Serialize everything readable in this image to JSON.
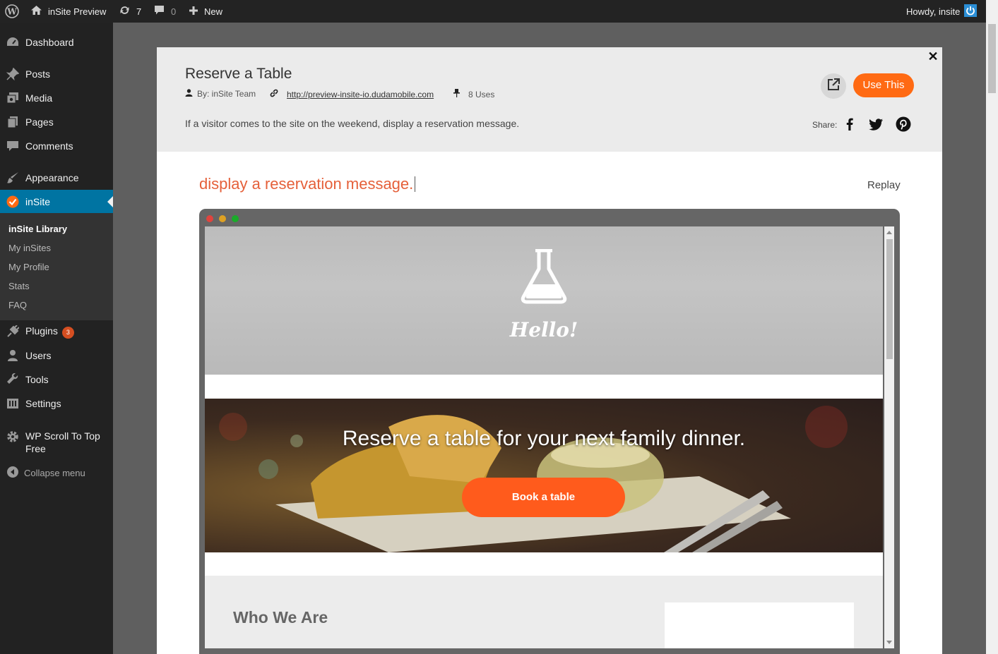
{
  "adminbar": {
    "site_name": "inSite Preview",
    "updates_count": "7",
    "comments_count": "0",
    "new_label": "New",
    "greeting": "Howdy, insite"
  },
  "sidebar": {
    "items": [
      {
        "label": "Dashboard",
        "icon": "dashboard-icon"
      },
      {
        "label": "Posts",
        "icon": "pin-icon"
      },
      {
        "label": "Media",
        "icon": "media-icon"
      },
      {
        "label": "Pages",
        "icon": "pages-icon"
      },
      {
        "label": "Comments",
        "icon": "comment-icon"
      },
      {
        "label": "Appearance",
        "icon": "brush-icon"
      },
      {
        "label": "inSite",
        "icon": "check-circle-icon"
      },
      {
        "label": "Plugins",
        "icon": "plug-icon",
        "badge": "3"
      },
      {
        "label": "Users",
        "icon": "user-icon"
      },
      {
        "label": "Tools",
        "icon": "wrench-icon"
      },
      {
        "label": "Settings",
        "icon": "settings-icon"
      },
      {
        "label": "WP Scroll To Top Free",
        "icon": "gear-icon"
      }
    ],
    "submenu": [
      "inSite Library",
      "My inSites",
      "My Profile",
      "Stats",
      "FAQ"
    ],
    "collapse_label": "Collapse menu"
  },
  "modal": {
    "title": "Reserve a Table",
    "author": "By: inSite Team",
    "url": "http://preview-insite-io.dudamobile.com",
    "uses": "8 Uses",
    "description": "If a visitor comes to the site on the weekend, display a reservation message.",
    "use_button": "Use This",
    "share_label": "Share:",
    "typed_text": "display a reservation message.",
    "replay_label": "Replay"
  },
  "preview": {
    "hero_text": "Hello!",
    "food_message": "Reserve a table for your next family dinner.",
    "book_button": "Book a table",
    "who_title": "Who We Are"
  },
  "colors": {
    "accent_orange": "#ff6a13",
    "wp_blue": "#0074a2",
    "typed_text": "#e5603a"
  }
}
